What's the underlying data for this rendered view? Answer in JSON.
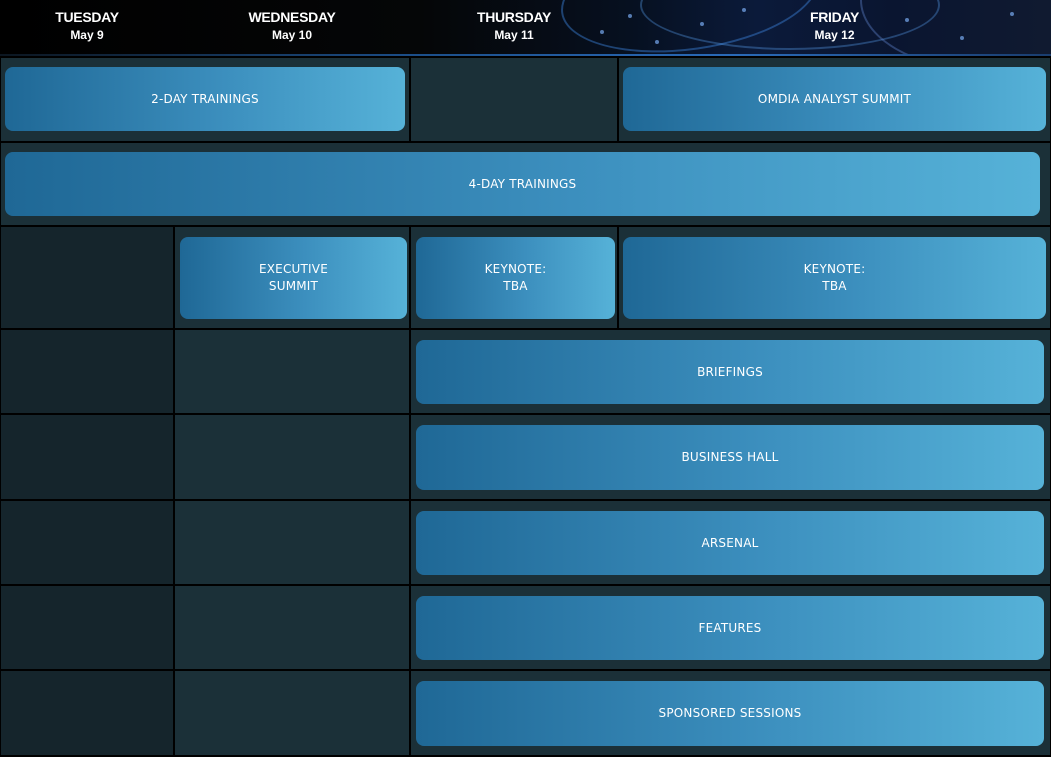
{
  "header": {
    "days": [
      {
        "name": "TUESDAY",
        "date": "May 9"
      },
      {
        "name": "WEDNESDAY",
        "date": "May 10"
      },
      {
        "name": "THURSDAY",
        "date": "May 11"
      },
      {
        "name": "FRIDAY",
        "date": "May 12"
      }
    ]
  },
  "schedule": {
    "two_day_trainings": "2-DAY TRAININGS",
    "omdia_summit": "OMDIA ANALYST SUMMIT",
    "four_day_trainings": "4-DAY TRAININGS",
    "executive_summit": "EXECUTIVE\nSUMMIT",
    "keynote_thursday": "KEYNOTE:\nTBA",
    "keynote_friday": "KEYNOTE:\nTBA",
    "briefings": "BRIEFINGS",
    "business_hall": "BUSINESS HALL",
    "arsenal": "ARSENAL",
    "features": "FEATURES",
    "sponsored_sessions": "SPONSORED SESSIONS"
  }
}
